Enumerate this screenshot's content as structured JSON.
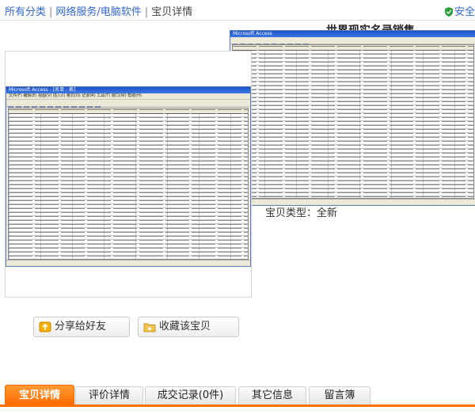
{
  "breadcrumb": {
    "items": [
      "所有分类",
      "网络服务/电脑软件",
      "宝贝详情"
    ]
  },
  "secure": {
    "label": "安全"
  },
  "heading": {
    "text": "世界现实名录销售"
  },
  "main_window": {
    "title": "Microsoft Access - [名单 : 表]"
  },
  "thumb_window": {
    "title": "Microsoft Access"
  },
  "item": {
    "type_label": "宝贝类型：全新"
  },
  "actions": {
    "share_label": "分享给好友",
    "collect_label": "收藏该宝贝"
  },
  "tabs": [
    {
      "label": "宝贝详情",
      "active": true
    },
    {
      "label": "评价详情",
      "active": false
    },
    {
      "label": "成交记录(0件)",
      "active": false
    },
    {
      "label": "其它信息",
      "active": false
    },
    {
      "label": "留言簿",
      "active": false
    }
  ],
  "colors": {
    "accent": "#ff7300",
    "link": "#3366cc",
    "titlebar": "#1d52c6"
  }
}
